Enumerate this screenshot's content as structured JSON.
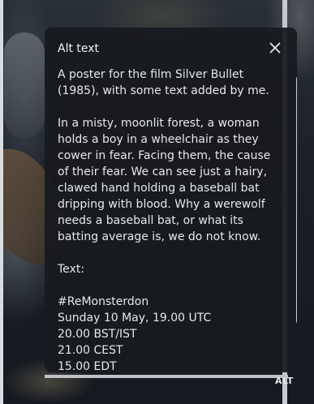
{
  "alt_dialog": {
    "title": "Alt text",
    "intro": "A poster for the film Silver Bullet (1985), with some text added by me.",
    "description": "In a misty, moonlit forest, a woman holds a boy in a wheelchair as they cower in fear. Facing them, the cause of their fear. We can see just a hairy, clawed hand holding a baseball bat dripping with blood. Why a werewolf needs a baseball bat, or what its batting average is, we do not know.",
    "text_heading": "Text:",
    "hashtag": "#ReMonsterdon",
    "date_line": "Sunday 10 May, 19.00 UTC",
    "time_bst": "20.00 BST/IST",
    "time_cest": "21.00 CEST",
    "time_edt": "15.00 EDT",
    "close_icon": "close-icon"
  },
  "alt_badge": "ALT"
}
